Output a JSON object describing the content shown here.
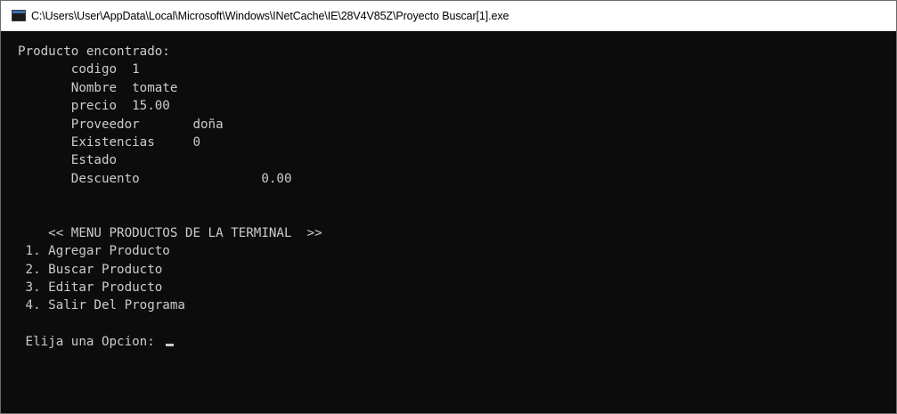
{
  "window": {
    "title": "C:\\Users\\User\\AppData\\Local\\Microsoft\\Windows\\INetCache\\IE\\28V4V85Z\\Proyecto Buscar[1].exe",
    "icon": "console-app-icon"
  },
  "console": {
    "result_header": "Producto encontrado:",
    "fields": {
      "codigo": "       codigo  1",
      "nombre": "       Nombre  tomate",
      "precio": "       precio  15.00",
      "proveedor": "       Proveedor       doña",
      "existencias": "       Existencias     0",
      "estado": "       Estado",
      "descuento": "       Descuento                0.00"
    },
    "menu": {
      "title": "    << MENU PRODUCTOS DE LA TERMINAL  >>",
      "options": [
        " 1. Agregar Producto",
        " 2. Buscar Producto",
        " 3. Editar Producto",
        " 4. Salir Del Programa"
      ],
      "prompt": " Elija una Opcion: "
    }
  },
  "colors": {
    "console_background": "#0c0c0c",
    "console_text": "#cccccc",
    "titlebar_background": "#ffffff"
  }
}
